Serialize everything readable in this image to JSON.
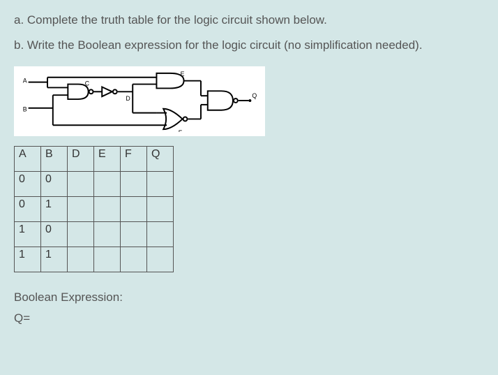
{
  "question": {
    "part_a": "a. Complete the truth table for the logic circuit shown below.",
    "part_b": "b. Write the Boolean expression for the logic circuit (no simplification needed)."
  },
  "circuit": {
    "labels": {
      "A": "A",
      "B": "B",
      "C": "C",
      "D": "D",
      "E": "E",
      "F": "F",
      "Q": "Q"
    }
  },
  "table": {
    "headers": [
      "A",
      "B",
      "D",
      "E",
      "F",
      "Q"
    ],
    "rows": [
      [
        "0",
        "0",
        "",
        "",
        "",
        ""
      ],
      [
        "0",
        "1",
        "",
        "",
        "",
        ""
      ],
      [
        "1",
        "0",
        "",
        "",
        "",
        ""
      ],
      [
        "1",
        "1",
        "",
        "",
        "",
        ""
      ]
    ]
  },
  "answer": {
    "label": "Boolean Expression:",
    "q_label": "Q="
  }
}
